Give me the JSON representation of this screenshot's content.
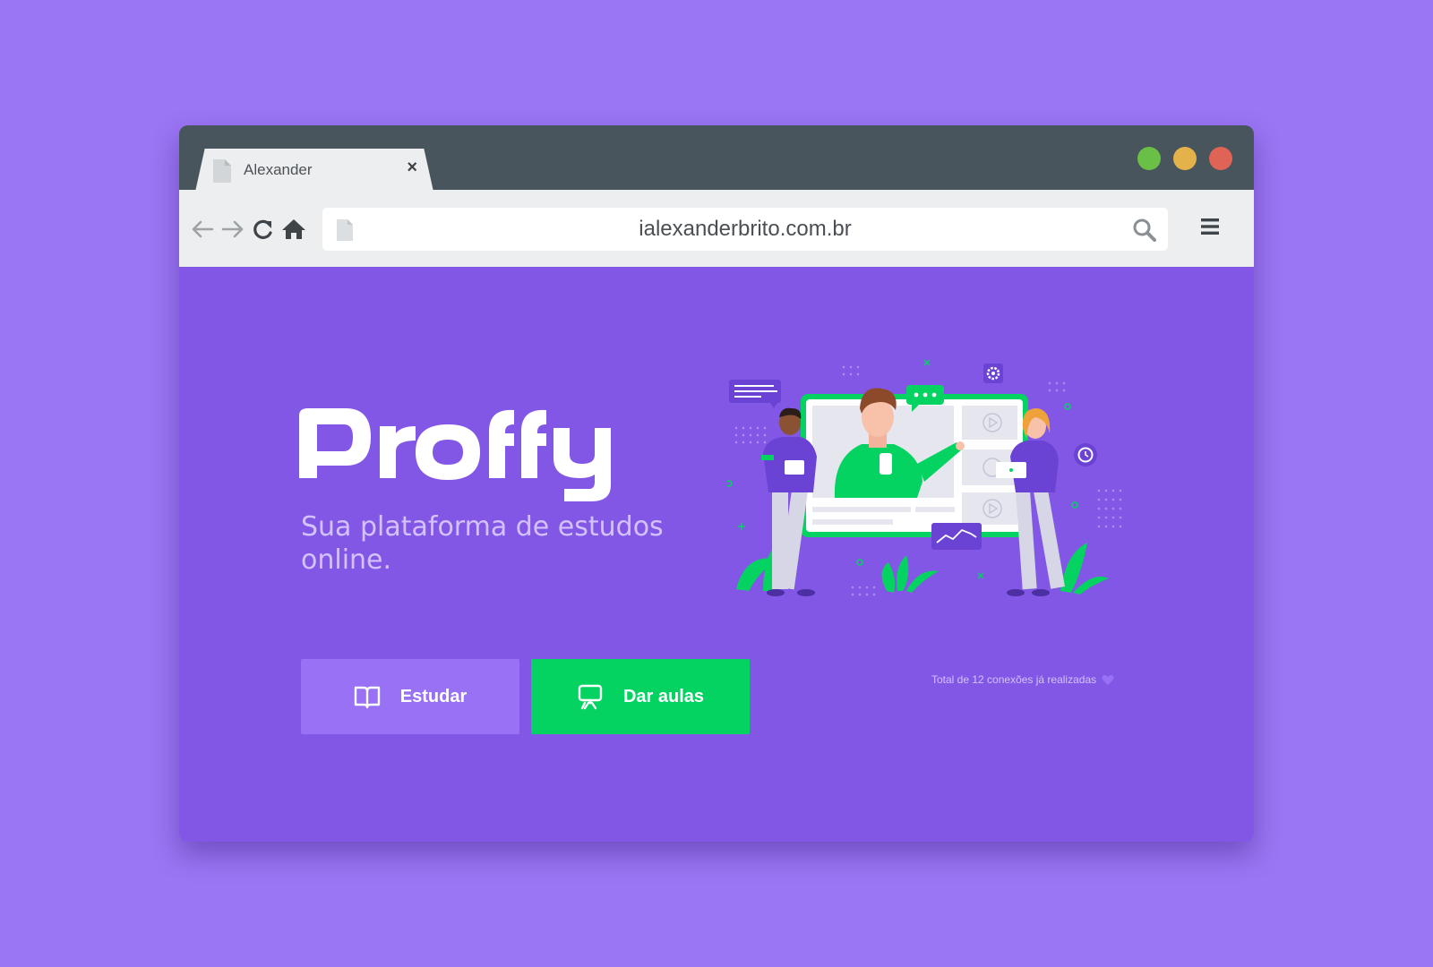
{
  "browser": {
    "tab": {
      "title": "Alexander",
      "close": "×"
    },
    "address_bar": {
      "url": "ialexanderbrito.com.br"
    },
    "window_controls": [
      "#6ac046",
      "#e3b24a",
      "#e06456"
    ]
  },
  "page": {
    "tagline_line1": "Sua plataforma de estudos",
    "tagline_line2": "online.",
    "buttons": {
      "study_label": "Estudar",
      "teach_label": "Dar aulas"
    },
    "connections_text": "Total de 12 conexões já realizadas"
  },
  "colors": {
    "background": "#9a75f4",
    "primary": "#8257e5",
    "primary_light": "#9871f5",
    "secondary": "#04d361",
    "text_in_primary": "#d4c2ff",
    "titlebar": "#48555c",
    "toolbar": "#eceeef"
  },
  "icons": {
    "back": "arrow-left-icon",
    "forward": "arrow-right-icon",
    "reload": "reload-icon",
    "home": "home-icon",
    "search": "search-icon",
    "menu": "hamburger-menu-icon",
    "study": "book-open-icon",
    "teach": "presentation-board-icon",
    "heart": "heart-icon"
  }
}
